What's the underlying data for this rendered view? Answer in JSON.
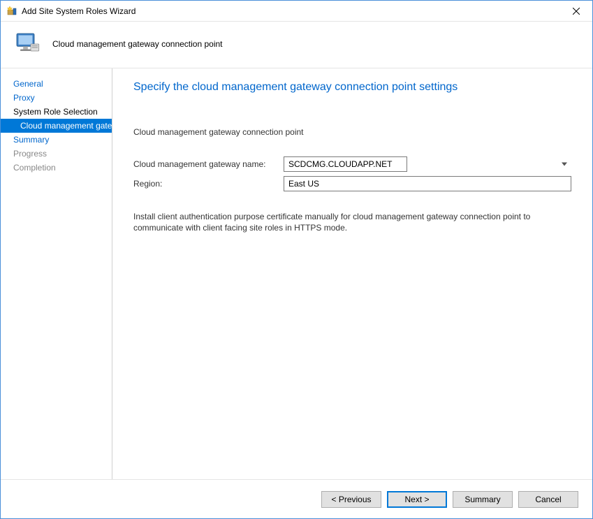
{
  "window": {
    "title": "Add Site System Roles Wizard"
  },
  "header": {
    "subtitle": "Cloud management gateway connection point"
  },
  "sidebar": {
    "items": [
      {
        "label": "General",
        "state": "link"
      },
      {
        "label": "Proxy",
        "state": "link"
      },
      {
        "label": "System Role Selection",
        "state": "plain"
      },
      {
        "label": "Cloud management gate",
        "state": "selected"
      },
      {
        "label": "Summary",
        "state": "link"
      },
      {
        "label": "Progress",
        "state": "grey"
      },
      {
        "label": "Completion",
        "state": "grey"
      }
    ]
  },
  "main": {
    "heading": "Specify the cloud management gateway connection point settings",
    "section_label": "Cloud management gateway connection point",
    "gateway_name_label": "Cloud management gateway name:",
    "gateway_name_value": "SCDCMG.CLOUDAPP.NET",
    "region_label": "Region:",
    "region_value": "East US",
    "note": "Install client authentication purpose certificate manually for cloud management gateway connection point to communicate with client facing site roles in HTTPS mode."
  },
  "footer": {
    "previous": "< Previous",
    "next": "Next >",
    "summary": "Summary",
    "cancel": "Cancel"
  }
}
